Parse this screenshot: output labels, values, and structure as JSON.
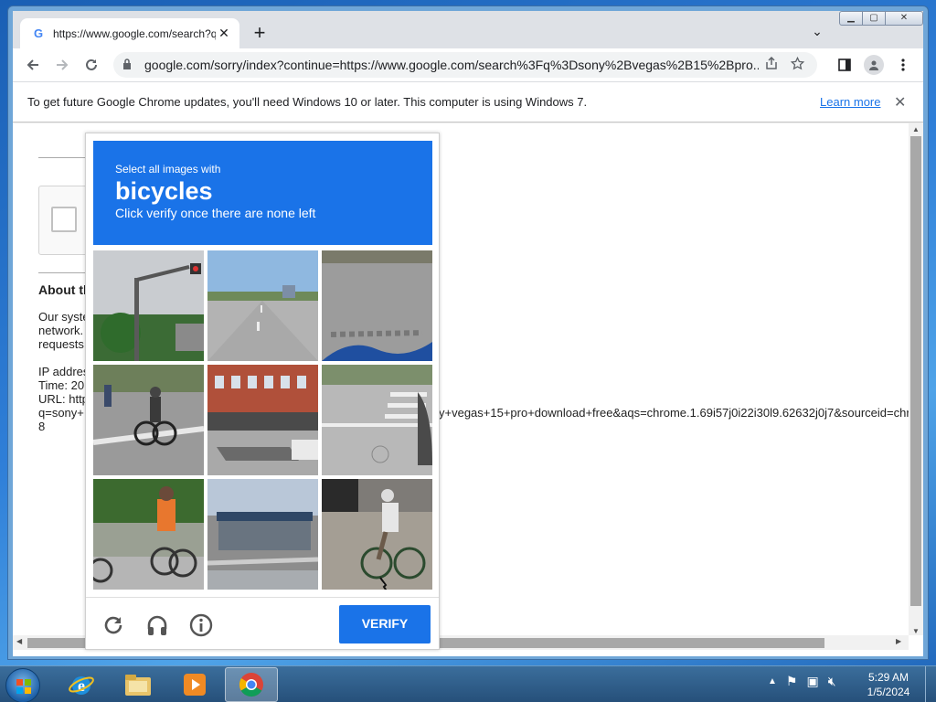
{
  "browser": {
    "tab": {
      "favicon": "G",
      "title": "https://www.google.com/search?q=",
      "close": "✕"
    },
    "new_tab": "+",
    "tab_search": "⌄",
    "window_controls": {
      "minimize": "▁",
      "maximize": "▢",
      "close": "✕"
    },
    "url": "google.com/sorry/index?continue=https://www.google.com/search%3Fq%3Dsony%2Bvegas%2B15%2Bpro..."
  },
  "infobar": {
    "message": "To get future Google Chrome updates, you'll need Windows 10 or later. This computer is using Windows 7.",
    "learn_more": "Learn more",
    "close": "✕"
  },
  "page": {
    "about_heading": "About th",
    "lines": [
      "Our syste",
      "network.",
      "requests"
    ],
    "ip_label": "IP addres",
    "time_label": "Time: 20",
    "url_label": "URL: http",
    "query_start": "q=sony+",
    "query_end": "8",
    "url_tail": "y+vegas+15+pro+download+free&aqs=chrome.1.69i57j0i22i30l9.62632j0j7&sourceid=chr"
  },
  "captcha": {
    "instruction": "Select all images with",
    "target": "bicycles",
    "hint": "Click verify once there are none left",
    "tiles": [
      "traffic light pole street",
      "empty road intersection",
      "asphalt road close-up",
      "cyclist on crosswalk",
      "brick building with trailer",
      "crosswalk street corner",
      "person pushing bicycle",
      "bus shelter street",
      "cyclist riding bicycle"
    ],
    "verify_label": "VERIFY",
    "colors": {
      "accent": "#1a73e8"
    }
  },
  "taskbar": {
    "apps": [
      "internet-explorer",
      "file-explorer",
      "media-player",
      "chrome"
    ],
    "time": "5:29 AM",
    "date": "1/5/2024"
  }
}
